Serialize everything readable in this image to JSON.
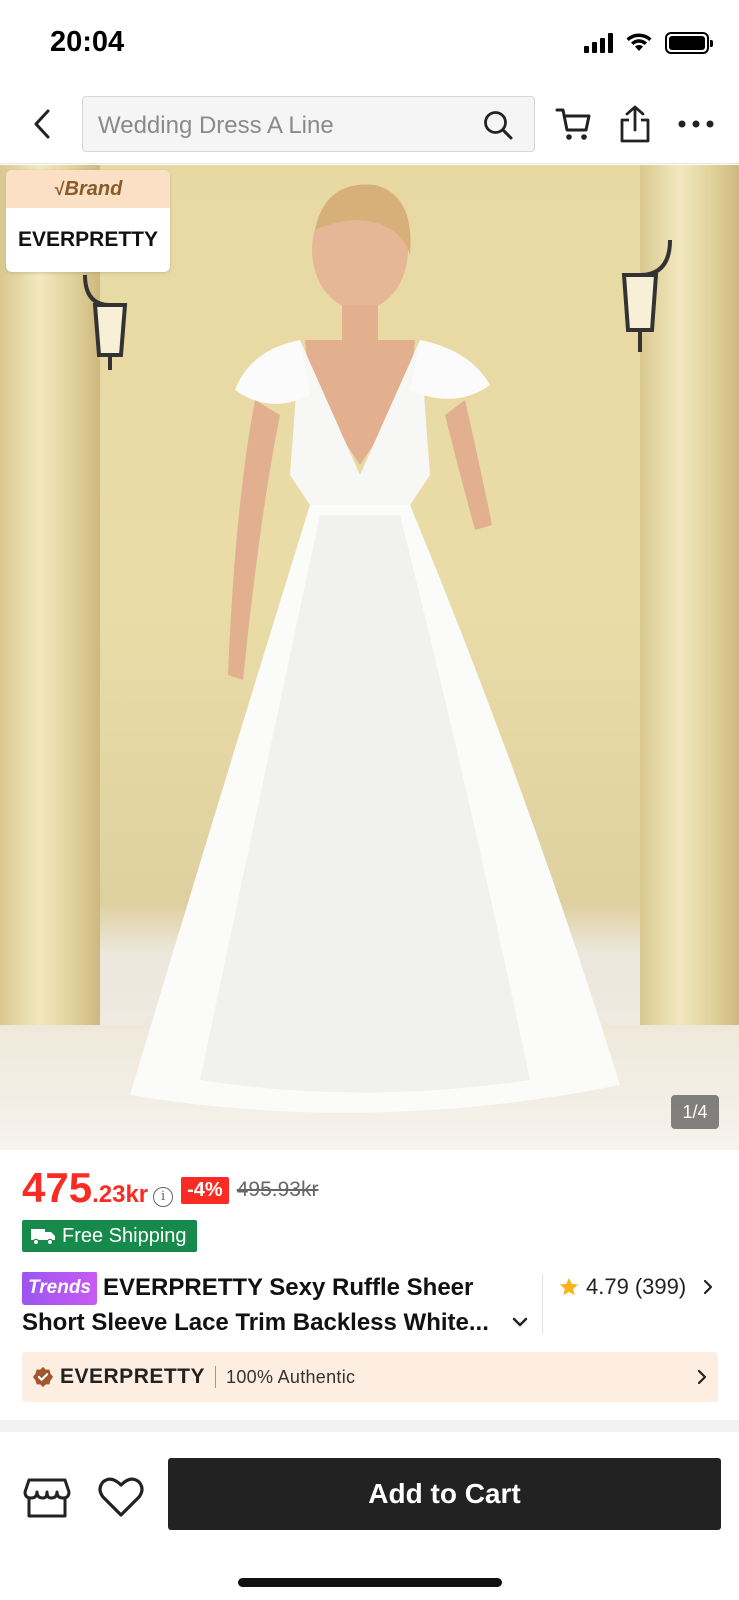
{
  "status_bar": {
    "time": "20:04"
  },
  "search": {
    "query": "Wedding Dress A Line"
  },
  "icons": {
    "back": "back-chevron-icon",
    "search": "search-icon",
    "cart": "cart-icon",
    "share": "share-icon",
    "more": "more-icon"
  },
  "hero": {
    "brand_tag_label": "Brand",
    "brand_tag_name": "EVERPRETTY",
    "image_counter": "1/4"
  },
  "price": {
    "main": "475",
    "cents": ".23kr",
    "discount": "-4%",
    "original": "495.93kr"
  },
  "shipping": {
    "label": "Free Shipping"
  },
  "product": {
    "badge": "Trends",
    "title_line1": "EVERPRETTY Sexy Ruffle Sheer",
    "title_line2": "Short Sleeve Lace Trim Backless White..."
  },
  "rating": {
    "value": "4.79",
    "count": "(399)"
  },
  "store": {
    "name": "EVERPRETTY",
    "authentic": "100% Authentic"
  },
  "bottom": {
    "add_to_cart": "Add to Cart"
  },
  "colors": {
    "price_red": "#fa2b22",
    "shipping_green": "#158a4a",
    "button_dark": "#222222",
    "trends_purple": "#9b55f0"
  }
}
